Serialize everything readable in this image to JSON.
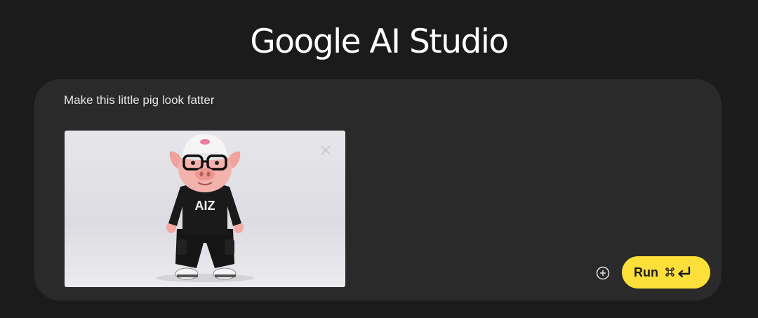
{
  "header": {
    "title": "Google AI Studio"
  },
  "prompt": {
    "text": "Make this little pig look fatter",
    "attachment": {
      "hoodie_text": "AIZ",
      "remove_icon": "close-icon"
    }
  },
  "toolbar": {
    "add_icon": "add-circle-icon",
    "run_label": "Run",
    "shortcut_icons": [
      "command-key-icon",
      "enter-key-icon"
    ]
  },
  "colors": {
    "background": "#1b1b1b",
    "card": "#2a2a2a",
    "run_button": "#fddf3a"
  }
}
